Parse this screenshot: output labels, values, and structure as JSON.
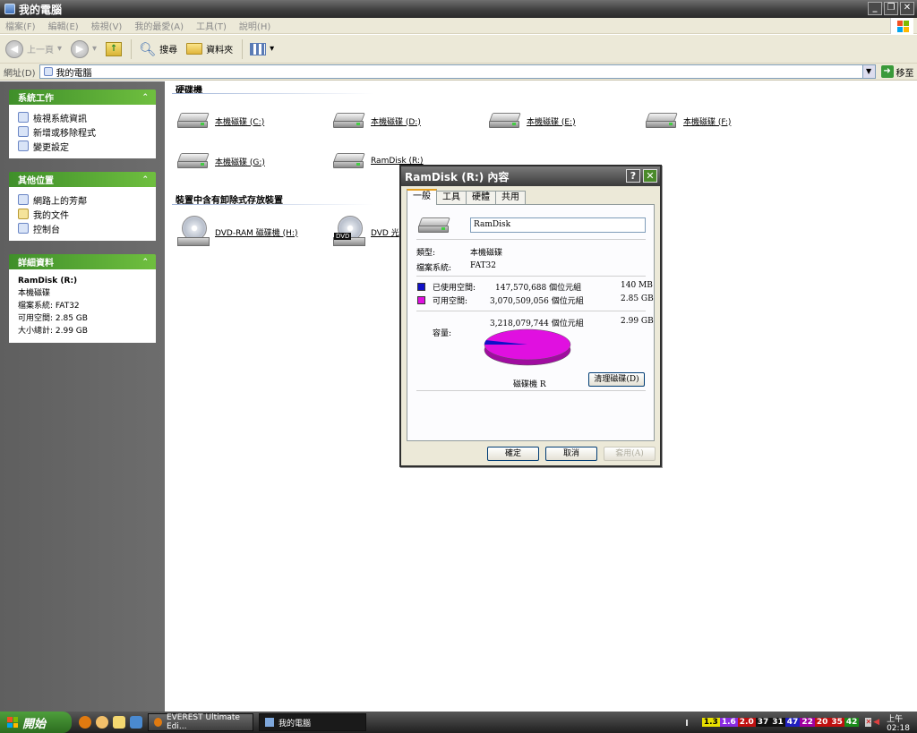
{
  "window": {
    "title": "我的電腦"
  },
  "menu": [
    "檔案(F)",
    "編輯(E)",
    "檢視(V)",
    "我的最愛(A)",
    "工具(T)",
    "說明(H)"
  ],
  "toolbar": {
    "back": "上一頁",
    "search": "搜尋",
    "folders": "資料夾"
  },
  "address": {
    "label": "網址(D)",
    "value": "我的電腦",
    "go": "移至"
  },
  "left": {
    "system_tasks": {
      "title": "系統工作",
      "items": [
        "檢視系統資訊",
        "新增或移除程式",
        "變更設定"
      ]
    },
    "other_places": {
      "title": "其他位置",
      "items": [
        "網路上的芳鄰",
        "我的文件",
        "控制台"
      ]
    },
    "details": {
      "title": "詳細資料",
      "name": "RamDisk (R:)",
      "type": "本機磁碟",
      "fs": "檔案系統: FAT32",
      "free": "可用空間: 2.85 GB",
      "total": "大小總計: 2.99 GB"
    }
  },
  "main": {
    "hdd_section": "硬碟機",
    "drives": [
      "本機磁碟 (C:)",
      "本機磁碟 (D:)",
      "本機磁碟 (E:)",
      "本機磁碟 (F:)",
      "本機磁碟 (G:)",
      "RamDisk (R:)"
    ],
    "removable_section": "裝置中含有卸除式存放裝置",
    "removable": [
      "DVD-RAM 磁碟機 (H:)",
      "DVD 光"
    ],
    "dvd_tag": "DVD"
  },
  "dialog": {
    "title": "RamDisk (R:) 內容",
    "help": "?",
    "tabs": [
      "一般",
      "工具",
      "硬體",
      "共用"
    ],
    "name": "RamDisk",
    "type_label": "類型:",
    "type_value": "本機磁碟",
    "fs_label": "檔案系統:",
    "fs_value": "FAT32",
    "used_label": "已使用空間:",
    "used_bytes": "147,570,688 個位元組",
    "used_size": "140 MB",
    "free_label": "可用空間:",
    "free_bytes": "3,070,509,056 個位元組",
    "free_size": "2.85 GB",
    "cap_label": "容量:",
    "cap_bytes": "3,218,079,744 個位元組",
    "cap_size": "2.99 GB",
    "drive_label": "磁碟機 R",
    "cleanup": "清理磁碟(D)",
    "ok": "確定",
    "cancel": "取消",
    "apply": "套用(A)",
    "colors": {
      "used": "#1010c8",
      "free": "#e010e0"
    },
    "usage": {
      "used_fraction": 0.0459,
      "free_fraction": 0.9541
    }
  },
  "taskbar": {
    "start": "開始",
    "tasks": [
      "EVEREST Ultimate Edi...",
      "我的電腦"
    ],
    "tray_nums": [
      "1.3",
      "1.6",
      "2.0",
      "37",
      "31",
      "47",
      "22",
      "20",
      "35",
      "42"
    ],
    "tray_colors": [
      "#e8e000",
      "#8a2be2",
      "#c01010",
      "#111111",
      "#111111",
      "#2020c0",
      "#a000a0",
      "#c01010",
      "#c01010",
      "#1a8a1a"
    ],
    "clock": "上午 02:18"
  }
}
